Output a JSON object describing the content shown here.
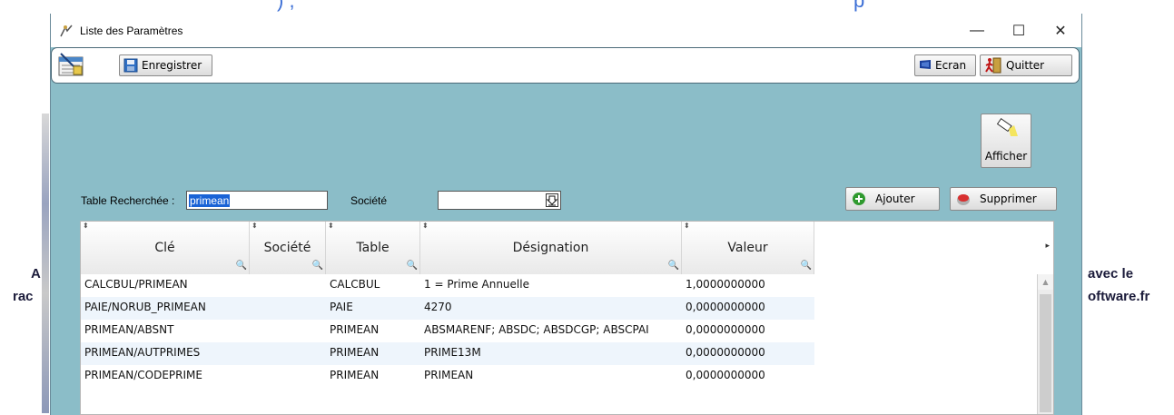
{
  "background": {
    "left_text_1": "A",
    "left_text_2": "rac",
    "right_text_1": "avec le",
    "right_text_2": "oftware.fr",
    "blue_text": ") ,",
    "blue_text_2": "p"
  },
  "window": {
    "title": "Liste des Paramètres",
    "minimize_glyph": "—",
    "maximize_glyph": "☐",
    "close_glyph": "✕"
  },
  "toolbar": {
    "save_label": "Enregistrer",
    "ecran_label": "Ecran",
    "quit_label": "Quitter"
  },
  "actions": {
    "afficher_label": "Afficher",
    "ajouter_label": "Ajouter",
    "supprimer_label": "Supprimer"
  },
  "filters": {
    "table_label": "Table Recherchée :",
    "table_value": "primean",
    "societe_label": "Société",
    "societe_value": ""
  },
  "grid": {
    "columns": [
      "Clé",
      "Société",
      "Table",
      "Désignation",
      "Valeur"
    ],
    "rows": [
      [
        "CALCBUL/PRIMEAN",
        "",
        "CALCBUL",
        "1 = Prime Annuelle",
        "1,0000000000"
      ],
      [
        "PAIE/NORUB_PRIMEAN",
        "",
        "PAIE",
        "4270",
        "0,0000000000"
      ],
      [
        "PRIMEAN/ABSNT",
        "",
        "PRIMEAN",
        "ABSMARENF; ABSDC; ABSDCGP; ABSCPAI",
        "0,0000000000"
      ],
      [
        "PRIMEAN/AUTPRIMES",
        "",
        "PRIMEAN",
        "PRIME13M",
        "0,0000000000"
      ],
      [
        "PRIMEAN/CODEPRIME",
        "",
        "PRIMEAN",
        "PRIMEAN",
        "0,0000000000"
      ]
    ]
  },
  "colors": {
    "window_bg": "#8bbdc8",
    "row_alt": "#eef5fc",
    "selection": "#1a63d6"
  }
}
